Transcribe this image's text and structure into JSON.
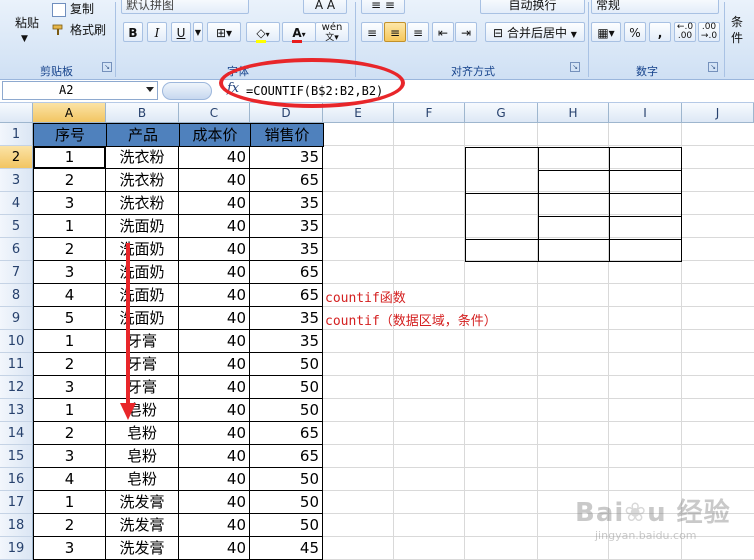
{
  "ribbon": {
    "clipboard": {
      "label": "剪贴板",
      "paste": "粘贴",
      "copy": "复制",
      "format_painter": "格式刷"
    },
    "font": {
      "label": "字体",
      "font_name": "默认拼图",
      "bold": "B",
      "italic": "I",
      "underline": "U",
      "font_color": "A",
      "phonetic": "wén"
    },
    "alignment": {
      "label": "对齐方式",
      "wrap": "自动换行",
      "merge": "合并后居中"
    },
    "number": {
      "label": "数字",
      "format": "常规",
      "percent": "%",
      "comma": ","
    },
    "styles": {
      "partial": "条件"
    }
  },
  "formula_bar": {
    "name_box": "A2",
    "fx": "fx",
    "formula": "=COUNTIF(B$2:B2,B2)"
  },
  "columns": [
    "A",
    "B",
    "C",
    "D",
    "E",
    "F",
    "G",
    "H",
    "I",
    "J"
  ],
  "selected_column": "A",
  "rows": [
    "1",
    "2",
    "3",
    "4",
    "5",
    "6",
    "7",
    "8",
    "9",
    "10",
    "11",
    "12",
    "13",
    "14",
    "15",
    "16",
    "17",
    "18",
    "19"
  ],
  "selected_row": "2",
  "table": {
    "headers": [
      "序号",
      "产品",
      "成本价",
      "销售价"
    ],
    "data": [
      [
        "1",
        "洗衣粉",
        "40",
        "35"
      ],
      [
        "2",
        "洗衣粉",
        "40",
        "65"
      ],
      [
        "3",
        "洗衣粉",
        "40",
        "35"
      ],
      [
        "1",
        "洗面奶",
        "40",
        "35"
      ],
      [
        "2",
        "洗面奶",
        "40",
        "35"
      ],
      [
        "3",
        "洗面奶",
        "40",
        "65"
      ],
      [
        "4",
        "洗面奶",
        "40",
        "65"
      ],
      [
        "5",
        "洗面奶",
        "40",
        "35"
      ],
      [
        "1",
        "牙膏",
        "40",
        "35"
      ],
      [
        "2",
        "牙膏",
        "40",
        "50"
      ],
      [
        "3",
        "牙膏",
        "40",
        "50"
      ],
      [
        "1",
        "皂粉",
        "40",
        "50"
      ],
      [
        "2",
        "皂粉",
        "40",
        "65"
      ],
      [
        "3",
        "皂粉",
        "40",
        "65"
      ],
      [
        "4",
        "皂粉",
        "40",
        "50"
      ],
      [
        "1",
        "洗发膏",
        "40",
        "50"
      ],
      [
        "2",
        "洗发膏",
        "40",
        "50"
      ],
      [
        "3",
        "洗发膏",
        "40",
        "45"
      ]
    ]
  },
  "notes": [
    "countif函数",
    "countif（数据区域，条件）"
  ],
  "watermark": "Baidu 经验 jingyan.baidu.com",
  "colors": {
    "header_fill": "#4f81bd",
    "annotation_red": "#e8262a",
    "note_text": "#d42020"
  }
}
